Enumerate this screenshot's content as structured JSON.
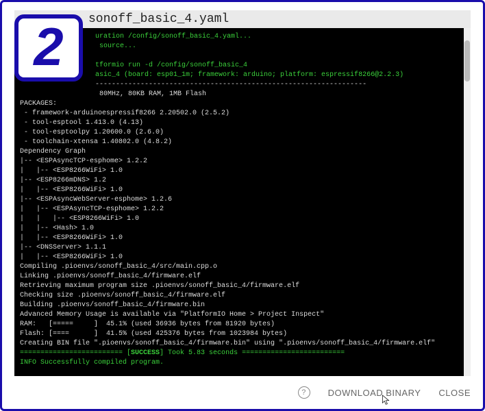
{
  "badge": {
    "number": "2"
  },
  "header": {
    "title": "sonoff_basic_4.yaml"
  },
  "lines": [
    {
      "cls": "green",
      "pad": true,
      "text": "uration /config/sonoff_basic_4.yaml..."
    },
    {
      "cls": "green",
      "pad": true,
      "text": " source..."
    },
    {
      "cls": "",
      "pad": true,
      "text": ""
    },
    {
      "cls": "green",
      "pad": true,
      "text": "tformio run -d /config/sonoff_basic_4"
    },
    {
      "cls": "green",
      "pad": true,
      "text": "asic_4 (board: esp01_1m; framework: arduino; platform: espressif8266@2.2.3)"
    },
    {
      "cls": "",
      "pad": true,
      "text": "------------------------------------------------------------------"
    },
    {
      "cls": "",
      "pad": true,
      "text": " 80MHz, 80KB RAM, 1MB Flash"
    },
    {
      "cls": "",
      "text": "PACKAGES:"
    },
    {
      "cls": "",
      "text": " - framework-arduinoespressif8266 2.20502.0 (2.5.2)"
    },
    {
      "cls": "",
      "text": " - tool-esptool 1.413.0 (4.13)"
    },
    {
      "cls": "",
      "text": " - tool-esptoolpy 1.20600.0 (2.6.0)"
    },
    {
      "cls": "",
      "text": " - toolchain-xtensa 1.40802.0 (4.8.2)"
    },
    {
      "cls": "",
      "text": "Dependency Graph"
    },
    {
      "cls": "",
      "text": "|-- <ESPAsyncTCP-esphome> 1.2.2"
    },
    {
      "cls": "",
      "text": "|   |-- <ESP8266WiFi> 1.0"
    },
    {
      "cls": "",
      "text": "|-- <ESP8266mDNS> 1.2"
    },
    {
      "cls": "",
      "text": "|   |-- <ESP8266WiFi> 1.0"
    },
    {
      "cls": "",
      "text": "|-- <ESPAsyncWebServer-esphome> 1.2.6"
    },
    {
      "cls": "",
      "text": "|   |-- <ESPAsyncTCP-esphome> 1.2.2"
    },
    {
      "cls": "",
      "text": "|   |   |-- <ESP8266WiFi> 1.0"
    },
    {
      "cls": "",
      "text": "|   |-- <Hash> 1.0"
    },
    {
      "cls": "",
      "text": "|   |-- <ESP8266WiFi> 1.0"
    },
    {
      "cls": "",
      "text": "|-- <DNSServer> 1.1.1"
    },
    {
      "cls": "",
      "text": "|   |-- <ESP8266WiFi> 1.0"
    },
    {
      "cls": "",
      "text": "Compiling .pioenvs/sonoff_basic_4/src/main.cpp.o"
    },
    {
      "cls": "",
      "text": "Linking .pioenvs/sonoff_basic_4/firmware.elf"
    },
    {
      "cls": "",
      "text": "Retrieving maximum program size .pioenvs/sonoff_basic_4/firmware.elf"
    },
    {
      "cls": "",
      "text": "Checking size .pioenvs/sonoff_basic_4/firmware.elf"
    },
    {
      "cls": "",
      "text": "Building .pioenvs/sonoff_basic_4/firmware.bin"
    },
    {
      "cls": "",
      "text": "Advanced Memory Usage is available via \"PlatformIO Home > Project Inspect\""
    },
    {
      "cls": "",
      "text": "RAM:   [=====     ]  45.1% (used 36936 bytes from 81920 bytes)"
    },
    {
      "cls": "",
      "text": "Flash: [====      ]  41.5% (used 425376 bytes from 1023984 bytes)"
    },
    {
      "cls": "",
      "text": "Creating BIN file \".pioenvs/sonoff_basic_4/firmware.bin\" using \".pioenvs/sonoff_basic_4/firmware.elf\""
    }
  ],
  "success_line": {
    "left": "========================= [",
    "mid": "SUCCESS",
    "right": "] Took 5.83 seconds ========================="
  },
  "final_line": {
    "label": "INFO",
    "rest": " Successfully compiled program."
  },
  "footer": {
    "download": "DOWNLOAD BINARY",
    "close": "CLOSE"
  }
}
